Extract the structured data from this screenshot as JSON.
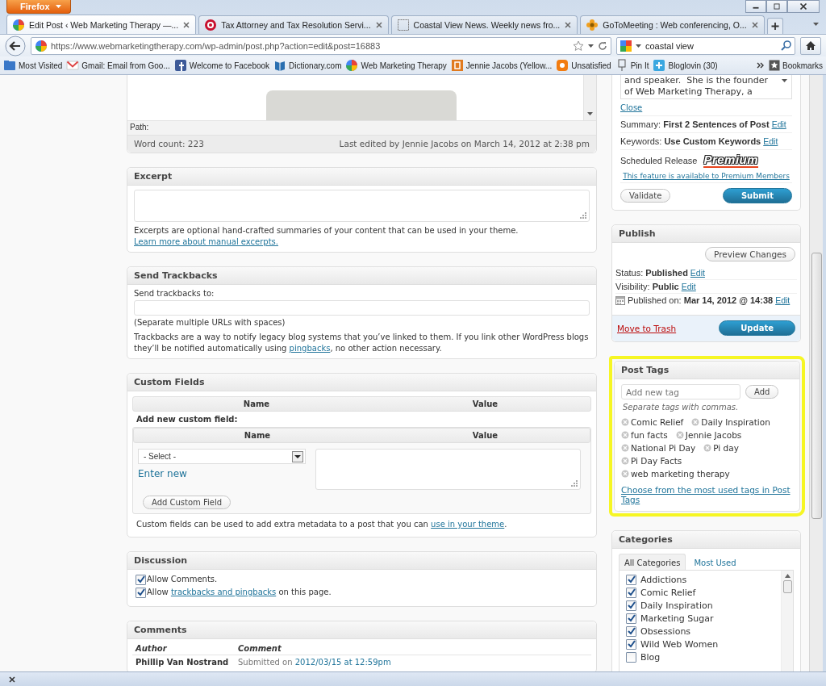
{
  "browser": {
    "menu_button": "Firefox",
    "tabs": [
      {
        "label": "Edit Post ‹ Web Marketing Therapy —...",
        "selected": true
      },
      {
        "label": "Tax Attorney and Tax Resolution Servi...",
        "selected": false
      },
      {
        "label": "Coastal View News. Weekly news fro...",
        "selected": false
      },
      {
        "label": "GoToMeeting : Web conferencing, O...",
        "selected": false
      }
    ],
    "address": "https://www.webmarketingtherapy.com/wp-admin/post.php?action=edit&post=16883",
    "search": "coastal view",
    "bookmarks": [
      "Most Visited",
      "Gmail: Email from Goo...",
      "Welcome to Facebook",
      "Dictionary.com",
      "Web Marketing Therapy",
      "Jennie Jacobs (Yellow...",
      "Unsatisfied",
      "Pin It",
      "Bloglovin (30)"
    ],
    "bookmarks_menu": "Bookmarks"
  },
  "main": [
    {
      "kind": "editor",
      "path": "Path:",
      "word_count": "Word count: 223",
      "last_edited": "Last edited by Jennie Jacobs on March 14, 2012 at 2:38 pm"
    },
    {
      "kind": "excerpt",
      "title": "Excerpt",
      "help": {
        "before": "Excerpts are optional hand-crafted summaries of your content that can be used in your theme. ",
        "link": "Learn more about manual excerpts."
      }
    },
    {
      "kind": "trackbacks",
      "title": "Send Trackbacks",
      "label": "Send trackbacks to:",
      "hint": "(Separate multiple URLs with spaces)",
      "help": {
        "before": "Trackbacks are a way to notify legacy blog systems that you’ve linked to them. If you link other WordPress blogs they’ll be notified automatically using ",
        "link": "pingbacks",
        "after": ", no other action necessary."
      }
    },
    {
      "kind": "custom_fields",
      "title": "Custom Fields",
      "columns": [
        "Name",
        "Value"
      ],
      "add_label": "Add new custom field:",
      "new_columns": [
        "Name",
        "Value"
      ],
      "select": "- Select -",
      "enter_new": "Enter new",
      "button": "Add Custom Field",
      "help": {
        "before": "Custom fields can be used to add extra metadata to a post that you can ",
        "link": "use in your theme",
        "after": "."
      }
    },
    {
      "kind": "discussion",
      "title": "Discussion",
      "options": [
        {
          "checked": true,
          "before": "Allow Comments."
        },
        {
          "checked": true,
          "before": "Allow ",
          "link": "trackbacks and pingbacks",
          "after": " on this page."
        }
      ]
    },
    {
      "kind": "comments",
      "title": "Comments",
      "columns": [
        "Author",
        "Comment"
      ],
      "rows": [
        {
          "author": "Phillip Van Nostrand",
          "prefix": "Submitted on ",
          "date": "2012/03/15 at 12:59pm"
        }
      ]
    }
  ],
  "side": [
    {
      "kind": "seo",
      "bio": "and speaker.  She is the founder of Web Marketing Therapy, a",
      "close": "Close",
      "settings": [
        {
          "text": "Summary: **First 2 Sentences of Post**",
          "edit": "Edit"
        },
        {
          "text": "Keywords: **Use Custom Keywords**",
          "edit": "Edit"
        }
      ],
      "scheduled": "Scheduled Release",
      "premium_badge": "Premium",
      "premium_note": "This feature is available to Premium Members",
      "buttons": [
        {
          "label": "Validate",
          "kind": "secondary"
        },
        {
          "label": "Submit",
          "kind": "primary"
        }
      ]
    },
    {
      "kind": "publish",
      "title": "Publish",
      "preview": "Preview Changes",
      "rows": [
        {
          "text": "Status: **Published**",
          "edit": "Edit",
          "kind": "status"
        },
        {
          "text": "Visibility: **Public**",
          "edit": "Edit",
          "kind": "visibility"
        },
        {
          "text": "Published on: **Mar 14, 2012 @ 14:38**",
          "edit": "Edit",
          "kind": "date"
        }
      ],
      "trash": "Move to Trash",
      "update": "Update"
    },
    {
      "kind": "post_tags",
      "title": "Post Tags",
      "highlighted": true,
      "placeholder": "Add new tag",
      "button": "Add",
      "hint": "Separate tags with commas.",
      "tags": [
        "Comic Relief",
        "Daily Inspiration",
        "fun facts",
        "Jennie Jacobs",
        "National Pi Day",
        "Pi day",
        "Pi Day Facts",
        "web marketing therapy"
      ],
      "more_link": "Choose from the most used tags in Post Tags"
    },
    {
      "kind": "categories",
      "title": "Categories",
      "tabs": [
        {
          "label": "All Categories",
          "selected": true
        },
        {
          "label": "Most Used",
          "selected": false
        }
      ],
      "items": [
        {
          "label": "Addictions",
          "checked": true
        },
        {
          "label": "Comic Relief",
          "checked": true
        },
        {
          "label": "Daily Inspiration",
          "checked": true
        },
        {
          "label": "Marketing Sugar",
          "checked": true
        },
        {
          "label": "Obsessions",
          "checked": true
        },
        {
          "label": "Wild Web Women",
          "checked": true
        },
        {
          "label": "Blog",
          "checked": false
        }
      ]
    }
  ]
}
